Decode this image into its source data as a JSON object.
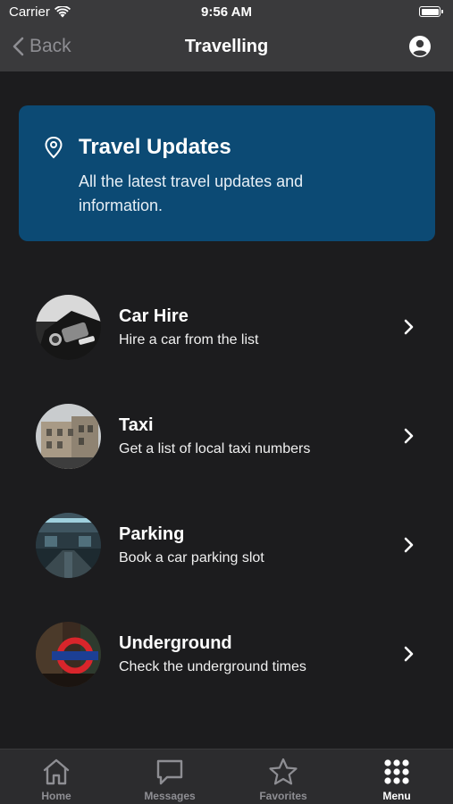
{
  "status": {
    "carrier": "Carrier",
    "time": "9:56 AM"
  },
  "nav": {
    "back_label": "Back",
    "title": "Travelling"
  },
  "banner": {
    "title": "Travel Updates",
    "description": "All the latest travel updates and information.",
    "color": "#0c4a74"
  },
  "items": [
    {
      "title": "Car Hire",
      "subtitle": "Hire a car from the list",
      "image": "car-interior"
    },
    {
      "title": "Taxi",
      "subtitle": "Get a list of local taxi numbers",
      "image": "city-street"
    },
    {
      "title": "Parking",
      "subtitle": "Book a car parking slot",
      "image": "parking-garage"
    },
    {
      "title": "Underground",
      "subtitle": "Check the underground times",
      "image": "underground-sign"
    }
  ],
  "tabs": [
    {
      "label": "Home",
      "icon": "home-icon"
    },
    {
      "label": "Messages",
      "icon": "message-icon"
    },
    {
      "label": "Favorites",
      "icon": "star-icon"
    },
    {
      "label": "Menu",
      "icon": "grid-menu-icon",
      "active": true
    }
  ]
}
